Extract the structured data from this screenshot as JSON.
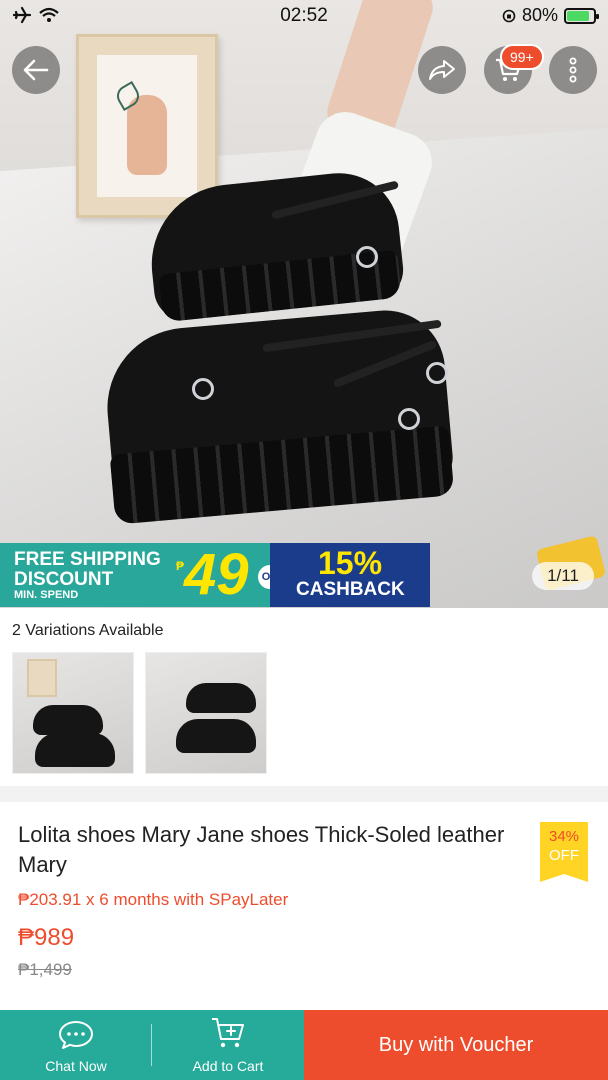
{
  "status_bar": {
    "time": "02:52",
    "battery_percent": "80%"
  },
  "hero": {
    "cart_badge": "99+",
    "image_counter": "1/11"
  },
  "promo_banner": {
    "line1": "FREE SHIPPING",
    "line2": "DISCOUNT",
    "line3": "MIN. SPEND",
    "currency": "₱",
    "amount": "49",
    "or": "OR",
    "cashback_pct": "15%",
    "cashback_label": "CASHBACK"
  },
  "variations": {
    "title": "2 Variations Available"
  },
  "product": {
    "title": "Lolita shoes Mary Jane shoes Thick-Soled leather Mary",
    "spaylater": "₱203.91 x 6 months with SPayLater",
    "price": "₱989",
    "original_price": "₱1,499",
    "discount_pct": "34%",
    "discount_label": "OFF"
  },
  "bottom_bar": {
    "chat_label": "Chat Now",
    "cart_label": "Add to Cart",
    "buy_label": "Buy with Voucher"
  },
  "colors": {
    "brand_orange": "#ee4d2d",
    "teal": "#26aa99",
    "badge_yellow": "#ffd424"
  }
}
